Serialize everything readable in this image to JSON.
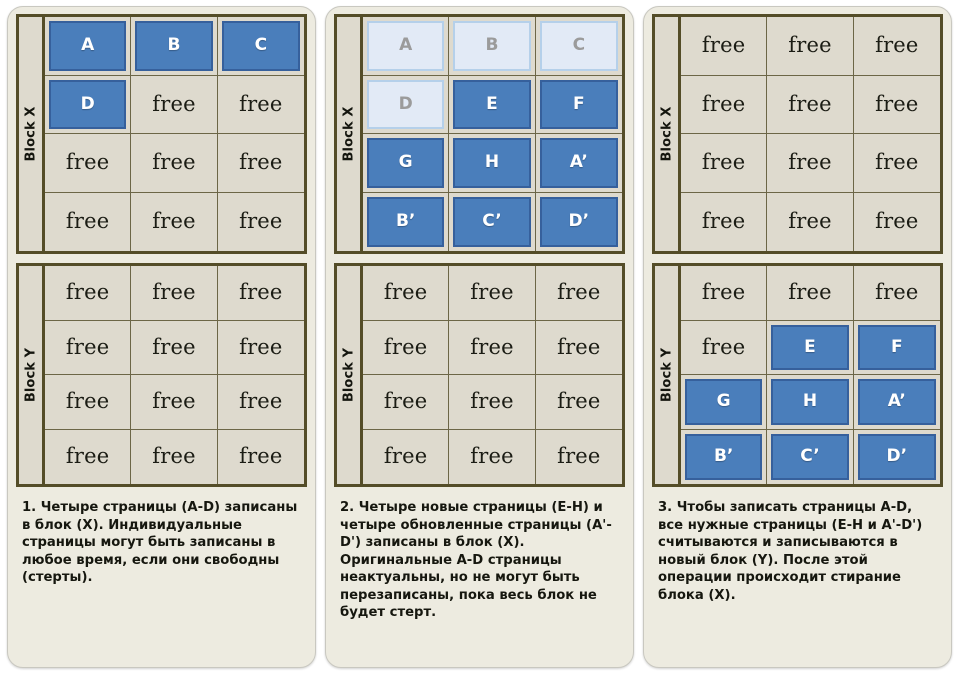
{
  "colors": {
    "page_background": "#ffffff",
    "panel_background": "#edebe0",
    "block_frame": "#544d28",
    "cell_background": "#dedace",
    "cell_gridline": "#6c6647",
    "page_live_fill": "#4a7ebb",
    "page_live_border": "#36609c",
    "page_stale_fill": "#e2eaf6",
    "page_stale_border": "#b5d0ea",
    "page_stale_text": "#9b9b9b",
    "text": "#16170f"
  },
  "labels": {
    "free": "free",
    "block_x": "Block X",
    "block_y": "Block Y"
  },
  "panels": [
    {
      "id": "panel-1",
      "blocks": [
        {
          "id": "block-x",
          "label": "Block X",
          "cells": [
            {
              "text": "A",
              "state": "live"
            },
            {
              "text": "B",
              "state": "live"
            },
            {
              "text": "C",
              "state": "live"
            },
            {
              "text": "D",
              "state": "live"
            },
            {
              "text": "free",
              "state": "free"
            },
            {
              "text": "free",
              "state": "free"
            },
            {
              "text": "free",
              "state": "free"
            },
            {
              "text": "free",
              "state": "free"
            },
            {
              "text": "free",
              "state": "free"
            },
            {
              "text": "free",
              "state": "free"
            },
            {
              "text": "free",
              "state": "free"
            },
            {
              "text": "free",
              "state": "free"
            }
          ]
        },
        {
          "id": "block-y",
          "label": "Block Y",
          "cells": [
            {
              "text": "free",
              "state": "free"
            },
            {
              "text": "free",
              "state": "free"
            },
            {
              "text": "free",
              "state": "free"
            },
            {
              "text": "free",
              "state": "free"
            },
            {
              "text": "free",
              "state": "free"
            },
            {
              "text": "free",
              "state": "free"
            },
            {
              "text": "free",
              "state": "free"
            },
            {
              "text": "free",
              "state": "free"
            },
            {
              "text": "free",
              "state": "free"
            },
            {
              "text": "free",
              "state": "free"
            },
            {
              "text": "free",
              "state": "free"
            },
            {
              "text": "free",
              "state": "free"
            }
          ]
        }
      ],
      "caption": "1. Четыре страницы (A-D) записаны в блок (X). Индивидуальные страницы могут быть записаны в любое время, если они свободны (стерты)."
    },
    {
      "id": "panel-2",
      "blocks": [
        {
          "id": "block-x",
          "label": "Block X",
          "cells": [
            {
              "text": "A",
              "state": "stale"
            },
            {
              "text": "B",
              "state": "stale"
            },
            {
              "text": "C",
              "state": "stale"
            },
            {
              "text": "D",
              "state": "stale"
            },
            {
              "text": "E",
              "state": "live"
            },
            {
              "text": "F",
              "state": "live"
            },
            {
              "text": "G",
              "state": "live"
            },
            {
              "text": "H",
              "state": "live"
            },
            {
              "text": "A’",
              "state": "live"
            },
            {
              "text": "B’",
              "state": "live"
            },
            {
              "text": "C’",
              "state": "live"
            },
            {
              "text": "D’",
              "state": "live"
            }
          ]
        },
        {
          "id": "block-y",
          "label": "Block Y",
          "cells": [
            {
              "text": "free",
              "state": "free"
            },
            {
              "text": "free",
              "state": "free"
            },
            {
              "text": "free",
              "state": "free"
            },
            {
              "text": "free",
              "state": "free"
            },
            {
              "text": "free",
              "state": "free"
            },
            {
              "text": "free",
              "state": "free"
            },
            {
              "text": "free",
              "state": "free"
            },
            {
              "text": "free",
              "state": "free"
            },
            {
              "text": "free",
              "state": "free"
            },
            {
              "text": "free",
              "state": "free"
            },
            {
              "text": "free",
              "state": "free"
            },
            {
              "text": "free",
              "state": "free"
            }
          ]
        }
      ],
      "caption": "2. Четыре новые страницы (E-H) и четыре обновленные страницы (A'-D') записаны в блок (X). Оригинальные A-D страницы неактуальны, но не могут быть перезаписаны, пока весь блок не будет стерт."
    },
    {
      "id": "panel-3",
      "blocks": [
        {
          "id": "block-x",
          "label": "Block X",
          "cells": [
            {
              "text": "free",
              "state": "free"
            },
            {
              "text": "free",
              "state": "free"
            },
            {
              "text": "free",
              "state": "free"
            },
            {
              "text": "free",
              "state": "free"
            },
            {
              "text": "free",
              "state": "free"
            },
            {
              "text": "free",
              "state": "free"
            },
            {
              "text": "free",
              "state": "free"
            },
            {
              "text": "free",
              "state": "free"
            },
            {
              "text": "free",
              "state": "free"
            },
            {
              "text": "free",
              "state": "free"
            },
            {
              "text": "free",
              "state": "free"
            },
            {
              "text": "free",
              "state": "free"
            }
          ]
        },
        {
          "id": "block-y",
          "label": "Block Y",
          "cells": [
            {
              "text": "free",
              "state": "free"
            },
            {
              "text": "free",
              "state": "free"
            },
            {
              "text": "free",
              "state": "free"
            },
            {
              "text": "free",
              "state": "free"
            },
            {
              "text": "E",
              "state": "live"
            },
            {
              "text": "F",
              "state": "live"
            },
            {
              "text": "G",
              "state": "live"
            },
            {
              "text": "H",
              "state": "live"
            },
            {
              "text": "A’",
              "state": "live"
            },
            {
              "text": "B’",
              "state": "live"
            },
            {
              "text": "C’",
              "state": "live"
            },
            {
              "text": "D’",
              "state": "live"
            }
          ]
        }
      ],
      "caption": "3. Чтобы записать страницы A-D, все нужные страницы (E-H и A'-D') считываются и записываются в новый блок (Y). После этой операции происходит стирание блока (X)."
    }
  ]
}
